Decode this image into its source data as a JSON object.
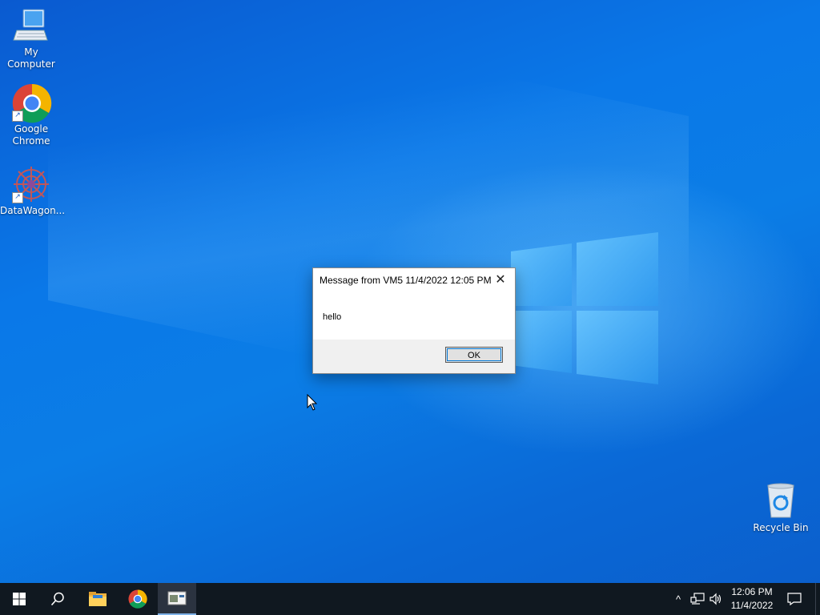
{
  "desktop": {
    "icons": [
      {
        "label": "My Computer",
        "icon": "computer-icon"
      },
      {
        "label": "Google Chrome",
        "icon": "chrome-icon"
      },
      {
        "label": "DataWagon...",
        "icon": "datawagon-icon"
      },
      {
        "label": "Recycle Bin",
        "icon": "recycle-bin-icon"
      }
    ]
  },
  "dialog": {
    "title": "Message from VM5 11/4/2022 12:05 PM",
    "close_glyph": "✕",
    "message": "hello",
    "ok_label": "OK"
  },
  "taskbar": {
    "start_icon": "windows-start-icon",
    "search_icon": "search-icon",
    "apps": [
      {
        "name": "File Explorer",
        "icon": "folder-icon"
      },
      {
        "name": "Google Chrome",
        "icon": "chrome-icon"
      },
      {
        "name": "Message window",
        "icon": "app-window-icon",
        "active": true
      }
    ],
    "tray": {
      "chevron_glyph": "^",
      "time": "12:06 PM",
      "date": "11/4/2022"
    }
  },
  "colors": {
    "desktop_blue": "#0a78e8",
    "taskbar": "#101820",
    "accent": "#0078d7"
  }
}
